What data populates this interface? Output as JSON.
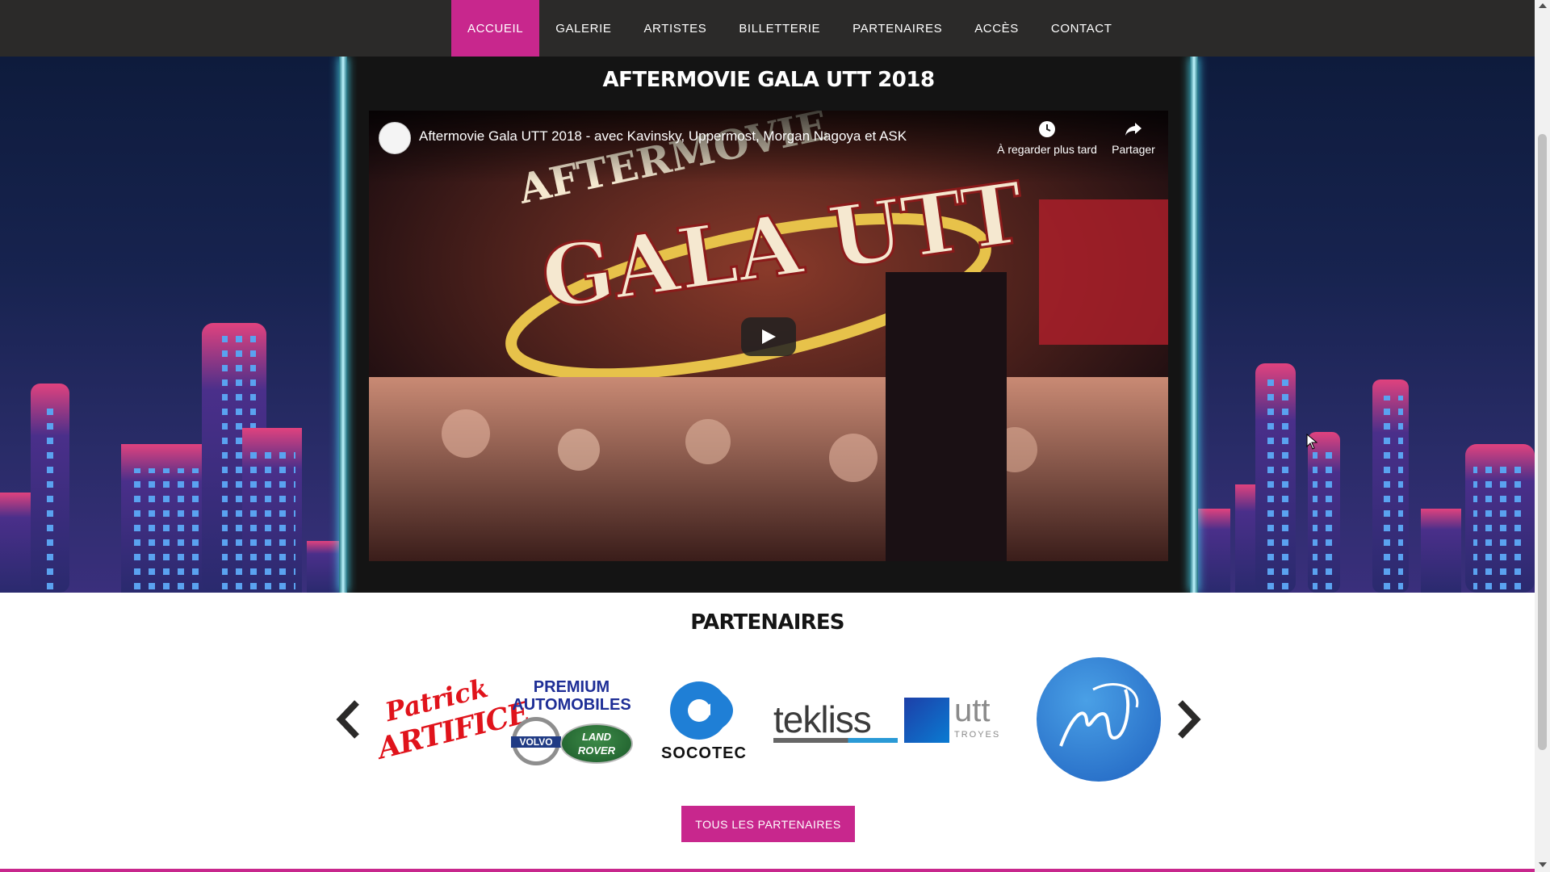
{
  "nav": {
    "items": [
      {
        "label": "ACCUEIL",
        "active": true
      },
      {
        "label": "GALERIE",
        "active": false
      },
      {
        "label": "ARTISTES",
        "active": false
      },
      {
        "label": "BILLETTERIE",
        "active": false
      },
      {
        "label": "PARTENAIRES",
        "active": false
      },
      {
        "label": "ACCÈS",
        "active": false
      },
      {
        "label": "CONTACT",
        "active": false
      }
    ]
  },
  "hero": {
    "title": "AFTERMOVIE GALA UTT 2018"
  },
  "video": {
    "title": "Aftermovie Gala UTT 2018 - avec Kavinsky, Uppermost, Morgan Nagoya et ASK",
    "watch_later_label": "À regarder plus tard",
    "share_label": "Partager",
    "thumbnail_text": {
      "line1": "AFTERMOVIE",
      "line2": "GALA UTT"
    }
  },
  "partners": {
    "title": "PARTENAIRES",
    "logos": {
      "artifice": {
        "line1": "Patrick",
        "line2": "ARTIFICE"
      },
      "premium": {
        "line1": "PREMIUM",
        "line2": "AUTOMOBILES",
        "volvo": "VOLVO",
        "landrover_1": "LAND",
        "landrover_2": "ROVER"
      },
      "socotec": "SOCOTEC",
      "tekliss": "tekliss",
      "utt": {
        "word": "utt",
        "sub": "TROYES"
      }
    },
    "button_label": "TOUS LES PARTENAIRES"
  },
  "colors": {
    "accent": "#c8278d",
    "nav_bg": "#2b2a29",
    "neon": "#47d8f2"
  }
}
